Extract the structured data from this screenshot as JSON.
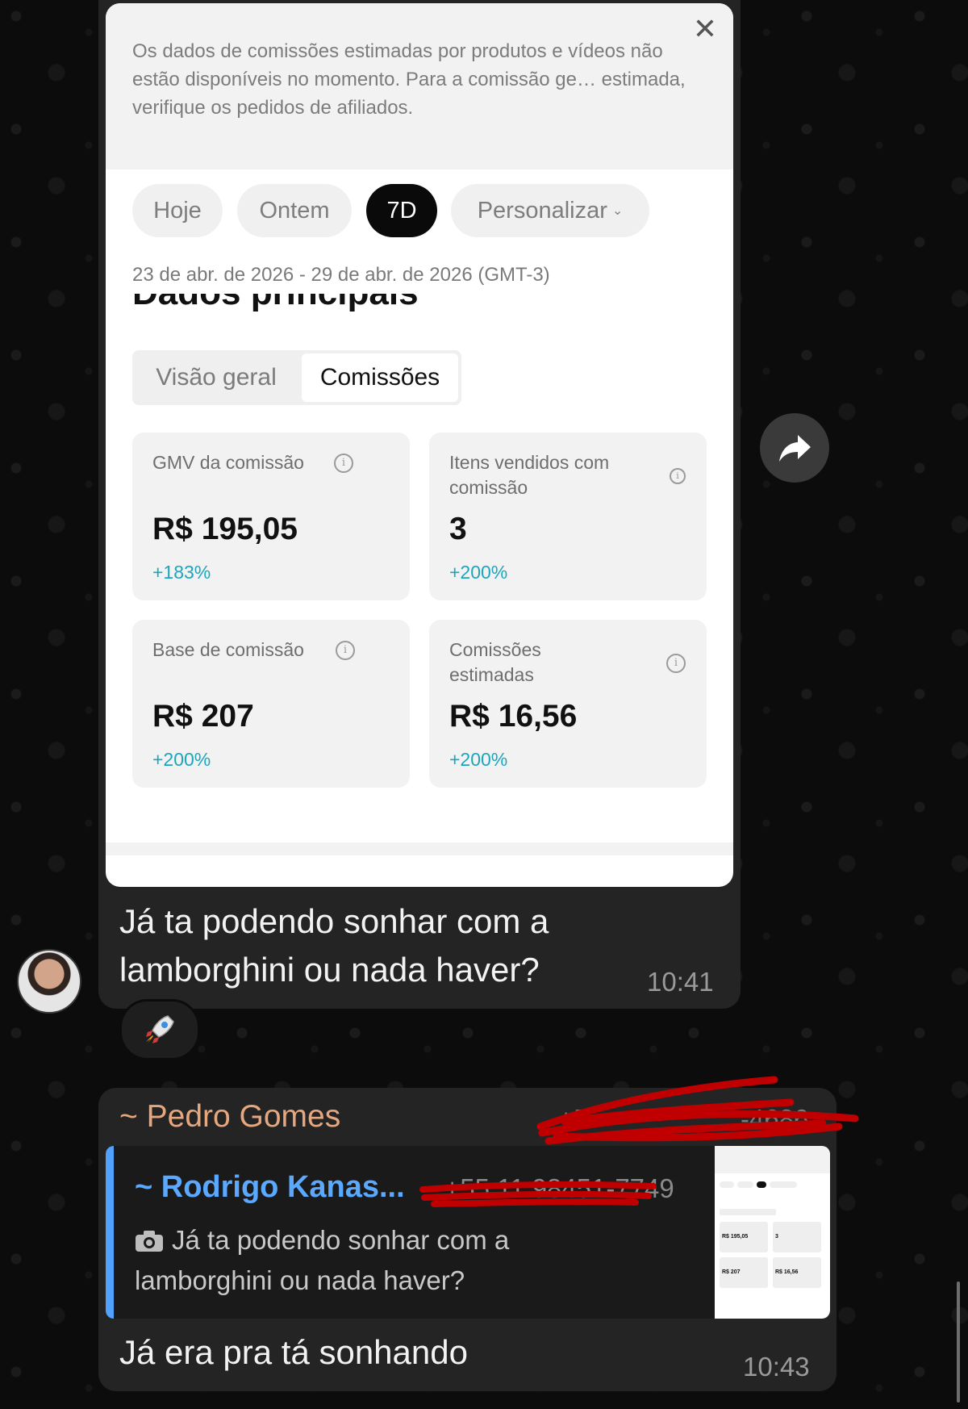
{
  "screenshot": {
    "banner_text": "Os dados de comissões estimadas por produtos e vídeos não estão disponíveis no momento. Para a comissão ge… estimada, verifique os pedidos de afiliados.",
    "filters": [
      "Hoje",
      "Ontem",
      "7D",
      "Personalizar"
    ],
    "active_filter": "7D",
    "date_range": "23 de abr. de 2026 - 29 de abr. de 2026 (GMT-3)",
    "section_title": "Dados principais",
    "tabs": [
      "Visão geral",
      "Comissões"
    ],
    "active_tab": "Comissões",
    "metrics": [
      {
        "label": "GMV da comissão",
        "value": "R$ 195,05",
        "change": "+183%"
      },
      {
        "label": "Itens vendidos com comissão",
        "value": "3",
        "change": "+200%"
      },
      {
        "label": "Base de comissão",
        "value": "R$ 207",
        "change": "+200%"
      },
      {
        "label": "Comissões estimadas",
        "value": "R$ 16,56",
        "change": "+200%"
      }
    ]
  },
  "message1": {
    "text": "Já ta podendo sonhar com a lamborghini ou nada haver?",
    "time": "10:41",
    "reaction": "rocket"
  },
  "message2": {
    "sender": "~ Pedro Gomes",
    "sender_phone": "+5",
    "sender_phone_tail": "-4686",
    "quote": {
      "author": "~ Rodrigo Kanas...",
      "phone": "+55 11 98451-7749",
      "text": "Já ta podendo sonhar com a lamborghini ou nada haver?"
    },
    "text": "Já era pra tá sonhando",
    "time": "10:43"
  },
  "colors": {
    "bubble": "#242424",
    "accent_teal": "#1ba6bd",
    "sender_name": "#e6a77f",
    "quote_author": "#5aa9ff",
    "redaction": "#c00000"
  }
}
